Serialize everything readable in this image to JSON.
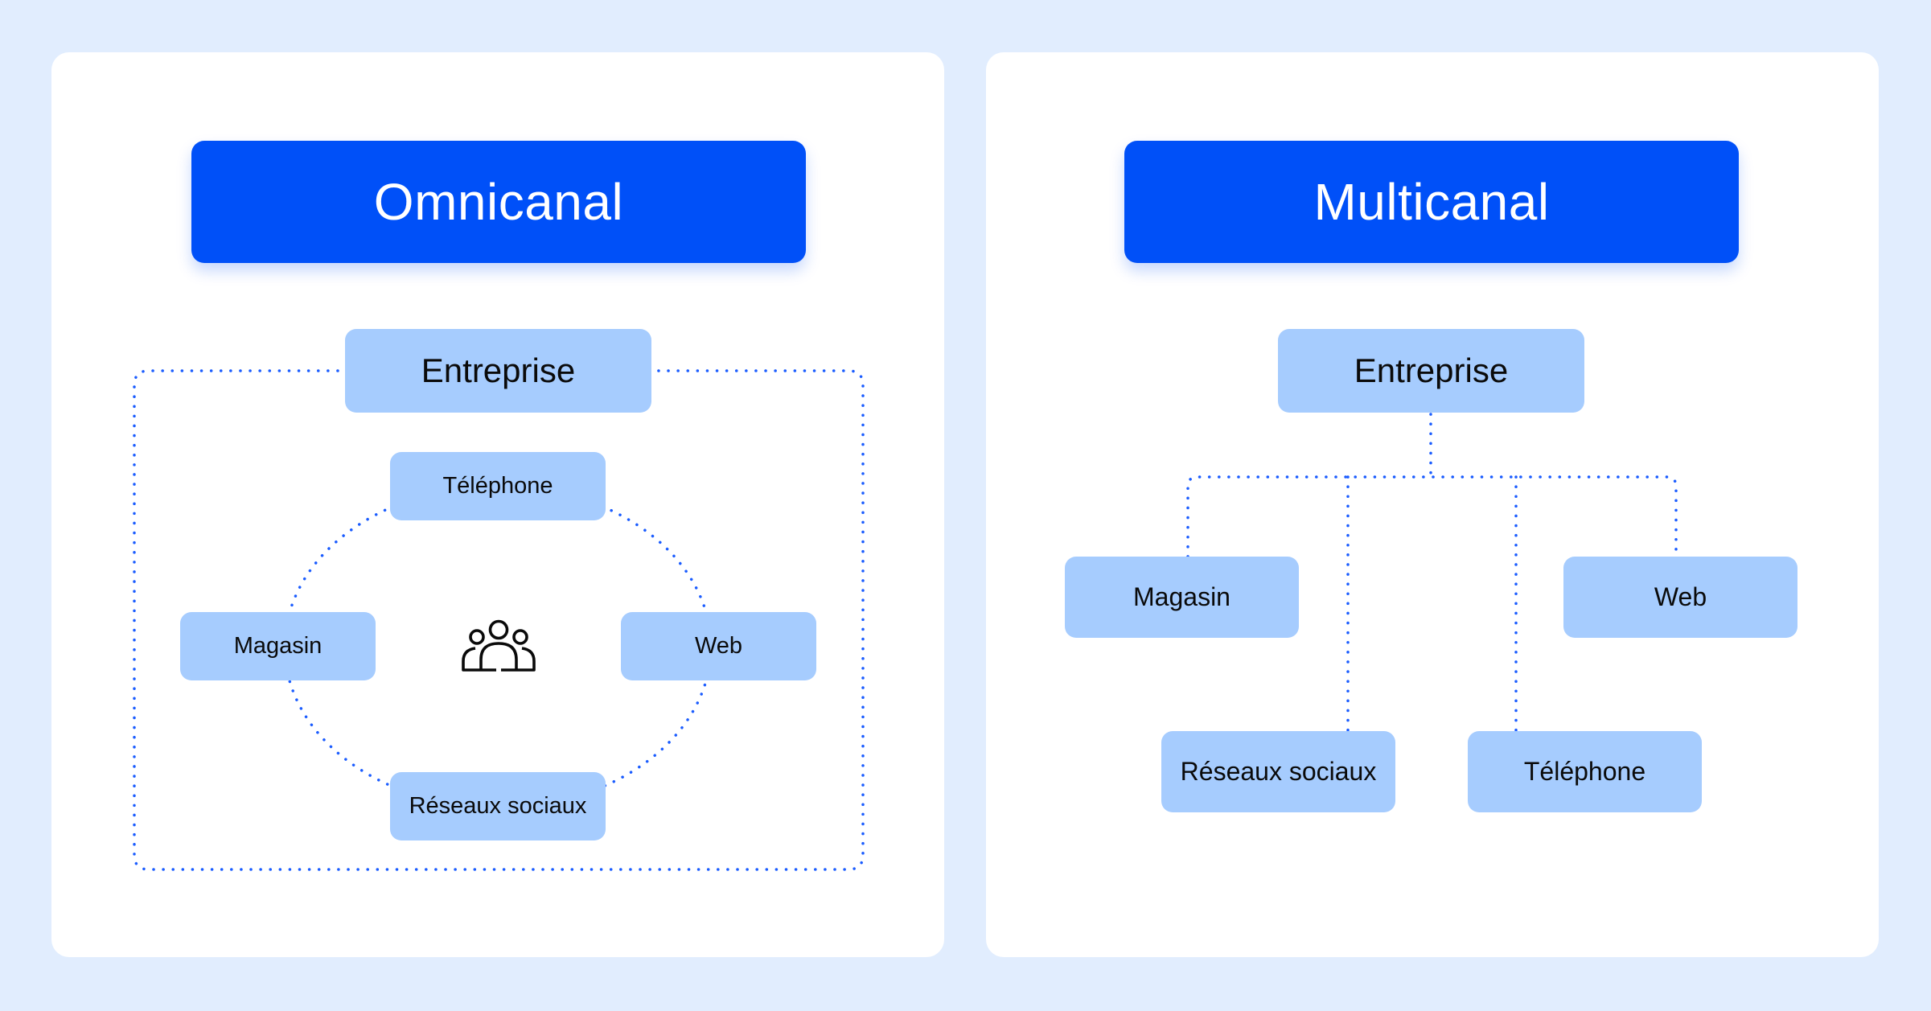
{
  "colors": {
    "background": "#E1EDFE",
    "card": "#FFFFFF",
    "title_fill": "#0050F8",
    "node_fill": "#A6CCFE",
    "connector": "#1A5CFF",
    "text": "#0A0A0A"
  },
  "omnichannel": {
    "title": "Omnicanal",
    "hub": "Entreprise",
    "center_icon": "people-group-icon",
    "channels": {
      "top": "Téléphone",
      "left": "Magasin",
      "right": "Web",
      "bottom": "Réseaux sociaux"
    }
  },
  "multichannel": {
    "title": "Multicanal",
    "hub": "Entreprise",
    "channels": {
      "upper_left": "Magasin",
      "upper_right": "Web",
      "lower_left": "Réseaux sociaux",
      "lower_right": "Téléphone"
    }
  }
}
